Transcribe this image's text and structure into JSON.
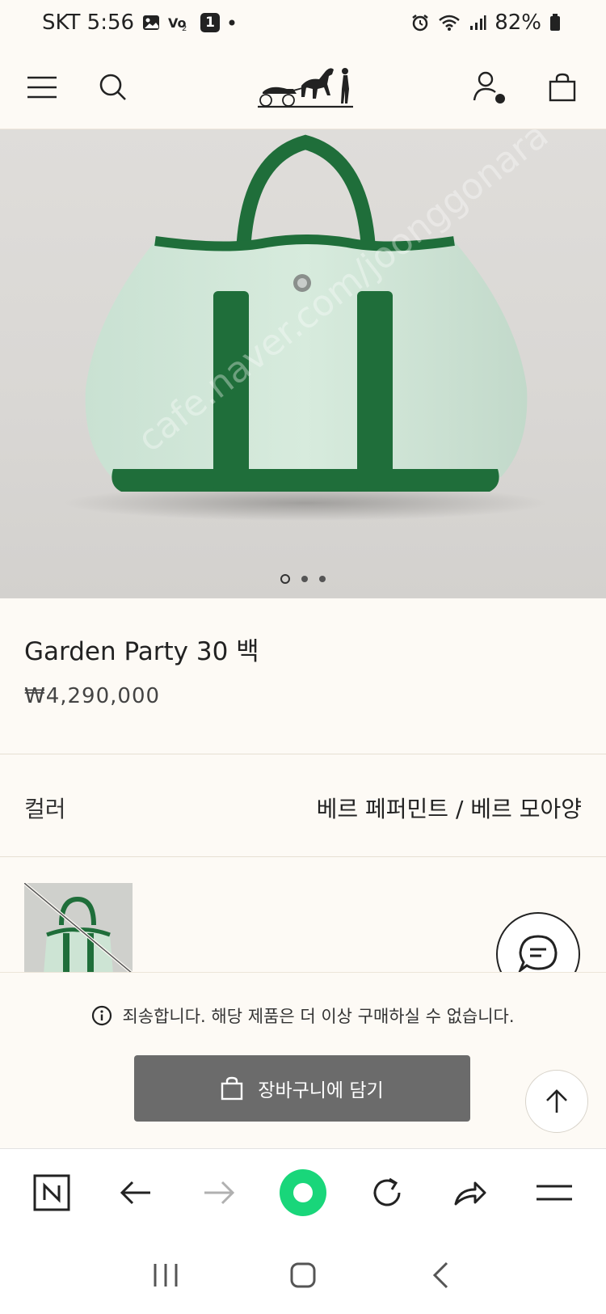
{
  "status_bar": {
    "carrier_time": "SKT 5:56",
    "badge_count": "1",
    "battery": "82%"
  },
  "header": {
    "brand": "HERMÈS",
    "icons": [
      "menu-icon",
      "search-icon",
      "brand-logo",
      "account-icon",
      "shopping-bag-icon"
    ]
  },
  "gallery": {
    "image_count": 3,
    "active_index": 0,
    "watermark_text": "cafe.naver.com/joonggonara"
  },
  "product": {
    "name": "Garden Party 30 백",
    "price": "₩4,290,000"
  },
  "color": {
    "label": "컬러",
    "value": "베르 페퍼민트 / 베르 모아양"
  },
  "notice": {
    "text": "죄송합니다. 해당 제품은 더 이상 구매하실 수 없습니다."
  },
  "cart": {
    "label": "장바구니에 담기"
  },
  "colors": {
    "background": "#fdfaf5",
    "bag_green": "#1f6e3a",
    "bag_canvas": "#cfe5d6",
    "button_disabled": "#6b6b6b",
    "browser_green": "#19d67a"
  }
}
